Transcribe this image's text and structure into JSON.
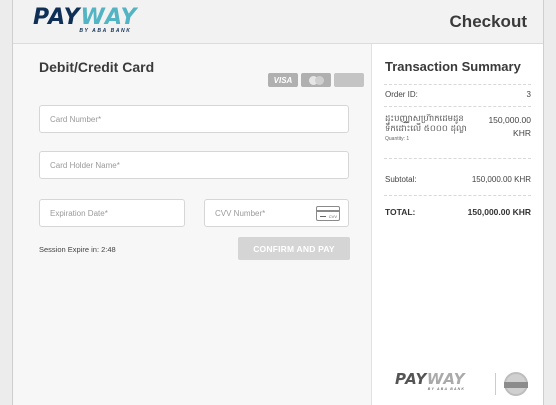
{
  "header": {
    "logo_main": "PAY",
    "logo_accent": "WAY",
    "logo_sub": "BY ABA BANK",
    "title": "Checkout"
  },
  "payment_form": {
    "title": "Debit/Credit Card",
    "card_logos": [
      "VISA",
      "MasterCard",
      "American Express"
    ],
    "card_number_placeholder": "Card Number*",
    "card_holder_placeholder": "Card Holder Name*",
    "expiration_placeholder": "Expiration Date*",
    "cvv_placeholder": "CVV Number*",
    "cvv_icon_text": "CVV",
    "session_expire": "Session Expire in: 2:48",
    "confirm_button": "CONFIRM AND PAY"
  },
  "summary": {
    "title": "Transaction Summary",
    "order_id_label": "Order ID:",
    "order_id_value": "3",
    "item_name": "ដុះបញ្ឈាសហ្រ៊ាកដេមដូន ទឹកដោះលើ ៥០០០ ដុល្លា",
    "item_quantity": "Quantity: 1",
    "item_price": "150,000.00",
    "item_currency": "KHR",
    "subtotal_label": "Subtotal:",
    "subtotal_value": "150,000.00 KHR",
    "total_label": "TOTAL:",
    "total_value": "150,000.00 KHR"
  },
  "footer": {
    "logo_main": "PAY",
    "logo_accent": "WAY",
    "logo_sub": "BY ABA BANK",
    "seal_icon": "trust-seal-icon"
  },
  "colors": {
    "brand_dark": "#0f2f57",
    "brand_accent": "#53b4c4",
    "button_disabled": "#d5d5d5"
  }
}
